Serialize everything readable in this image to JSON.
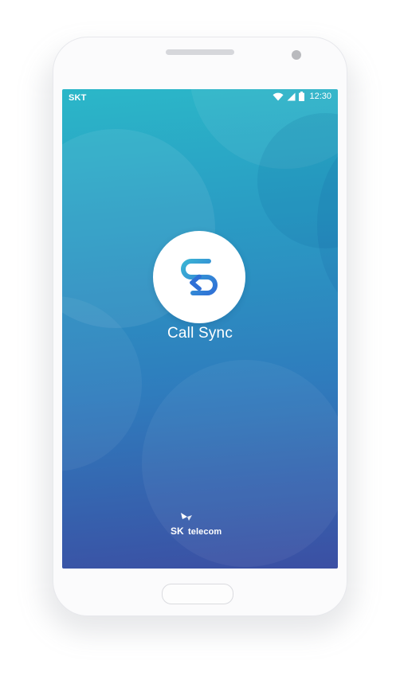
{
  "status_bar": {
    "carrier": "SKT",
    "time": "12:30",
    "icons": [
      "wifi-icon",
      "cell-signal-icon",
      "battery-icon"
    ]
  },
  "app": {
    "name": "Call Sync",
    "logo_icon": "sync-arrow-icon"
  },
  "brand": {
    "sk": "SK",
    "telecom": "telecom"
  },
  "colors": {
    "gradient_top": "#2bb7c8",
    "gradient_bottom": "#3b4fa3",
    "logo_accent": "#2f86d6",
    "logo_accent_light": "#3ab4d4"
  }
}
